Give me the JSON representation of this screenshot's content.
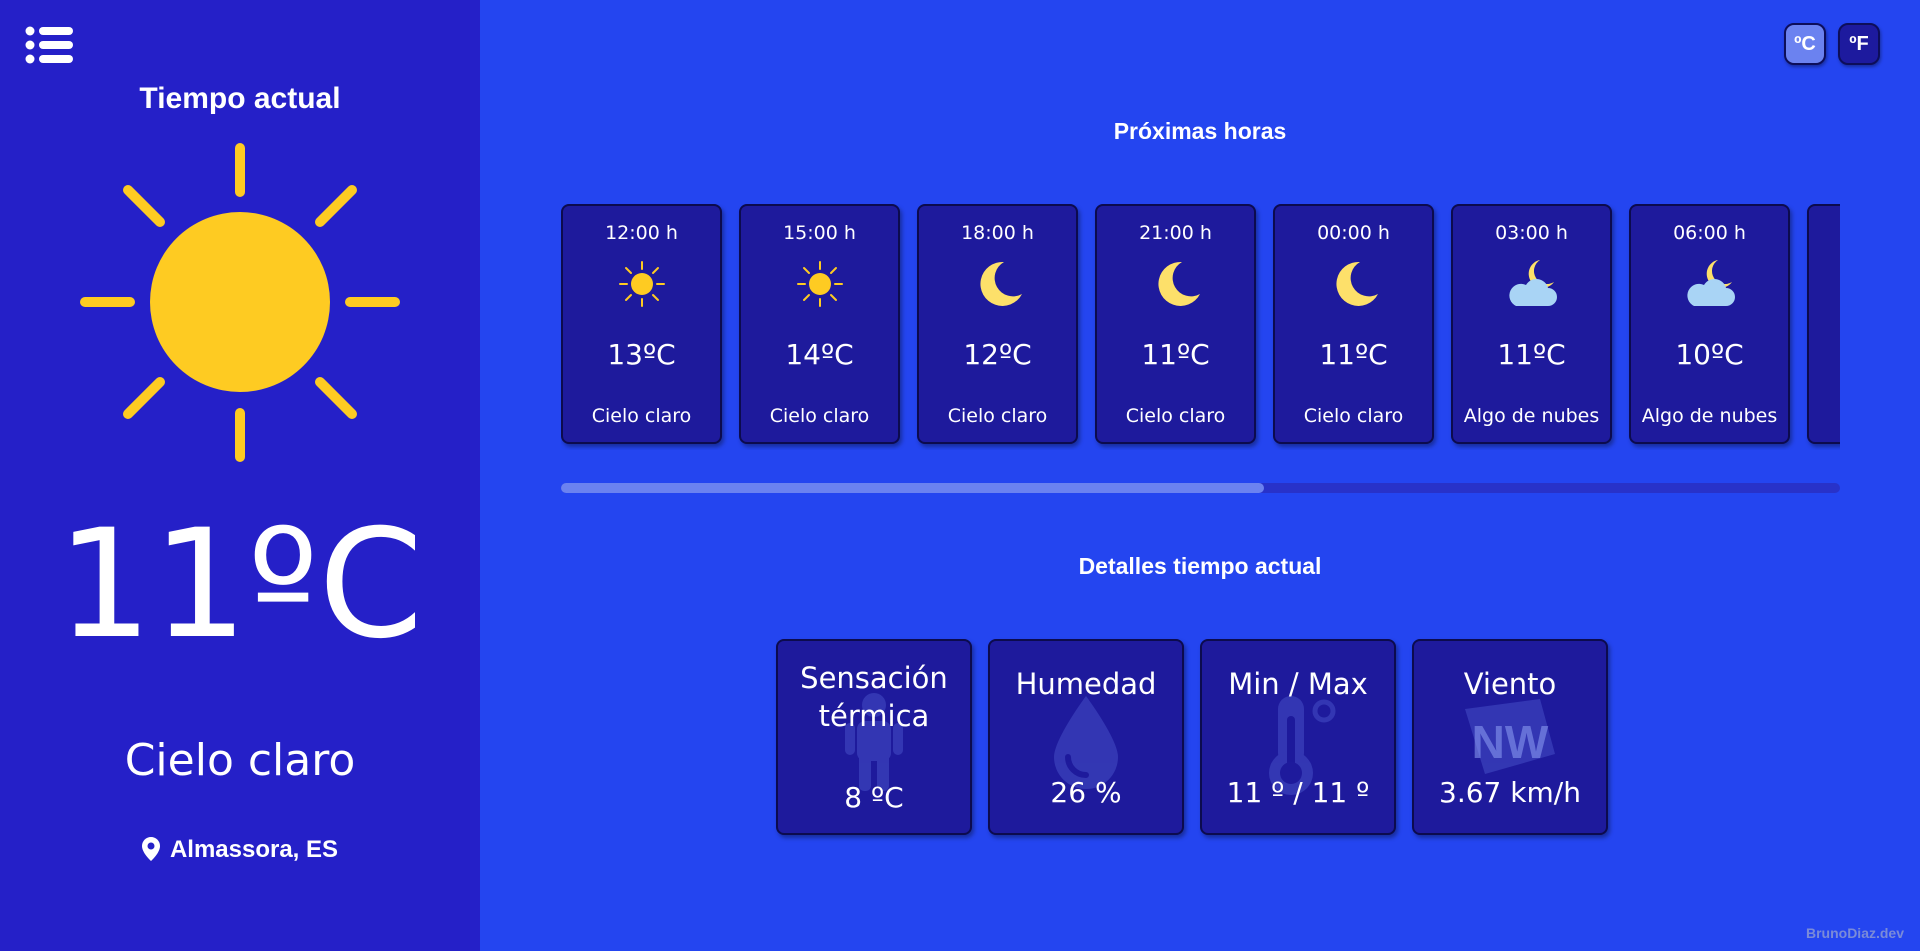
{
  "sidebar": {
    "title": "Tiempo actual",
    "current_icon": "sun-icon",
    "temperature": "11ºC",
    "description": "Cielo claro",
    "location": "Almassora, ES"
  },
  "units": {
    "celsius": "ºC",
    "fahrenheit": "ºF",
    "selected": "celsius"
  },
  "hourly": {
    "title": "Próximas horas",
    "scroll_fraction_visible": 0.55,
    "items": [
      {
        "time": "12:00 h",
        "icon": "sun-icon",
        "temp": "13ºC",
        "desc": "Cielo claro"
      },
      {
        "time": "15:00 h",
        "icon": "sun-icon",
        "temp": "14ºC",
        "desc": "Cielo claro"
      },
      {
        "time": "18:00 h",
        "icon": "moon-icon",
        "temp": "12ºC",
        "desc": "Cielo claro"
      },
      {
        "time": "21:00 h",
        "icon": "moon-icon",
        "temp": "11ºC",
        "desc": "Cielo claro"
      },
      {
        "time": "00:00 h",
        "icon": "moon-icon",
        "temp": "11ºC",
        "desc": "Cielo claro"
      },
      {
        "time": "03:00 h",
        "icon": "moon-cloud-icon",
        "temp": "11ºC",
        "desc": "Algo de nubes"
      },
      {
        "time": "06:00 h",
        "icon": "moon-cloud-icon",
        "temp": "10ºC",
        "desc": "Algo de nubes"
      },
      {
        "time": "",
        "icon": "",
        "temp": "",
        "desc": ""
      }
    ]
  },
  "details": {
    "title": "Detalles tiempo actual",
    "feels_like": {
      "label": "Sensación térmica",
      "value": "8 ºC",
      "icon": "person-icon"
    },
    "humidity": {
      "label": "Humedad",
      "value": "26 %",
      "icon": "water-drop-icon"
    },
    "minmax": {
      "label": "Min / Max",
      "value": "11 º / 11 º",
      "icon": "thermometer-icon"
    },
    "wind": {
      "label": "Viento",
      "value": "3.67 km/h",
      "icon": "wind-direction-icon",
      "direction": "NW"
    }
  },
  "footer": "BrunoDiaz.dev",
  "colors": {
    "background": "#2445f0",
    "sidebar": "#2520c8",
    "card": "#1e1a9c",
    "sun": "#fecb22",
    "moon": "#fde06a",
    "cloud": "#a9d4f5"
  }
}
